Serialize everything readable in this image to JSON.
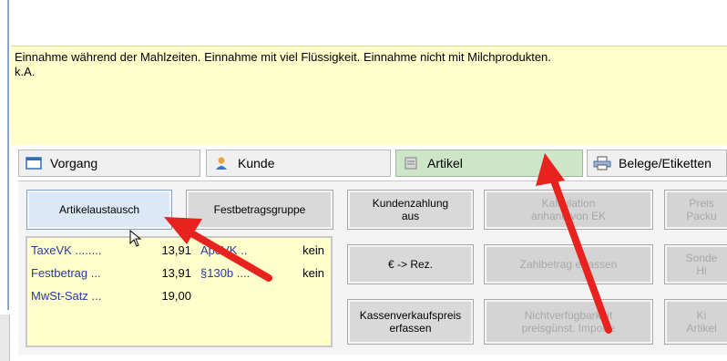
{
  "info": {
    "line1": "Einnahme während der Mahlzeiten. Einnahme mit viel Flüssigkeit. Einnahme nicht mit Milchprodukten.",
    "line2": "k.A."
  },
  "tabs": [
    {
      "label": "Vorgang",
      "icon": "window-icon"
    },
    {
      "label": "Kunde",
      "icon": "person-icon"
    },
    {
      "label": "Artikel",
      "icon": "article-icon"
    },
    {
      "label": "Belege/Etiketten",
      "icon": "printer-icon"
    }
  ],
  "buttons": {
    "artikelaustausch": "Artikelaustausch",
    "festbetragsgruppe": "Festbetragsgruppe",
    "kundenzahlung_1": "Kundenzahlung",
    "kundenzahlung_2": "aus",
    "kalkulation_1": "Kalkulation",
    "kalkulation_2": "anhand von EK",
    "preis_1": "Preis",
    "preis_2": "Packu",
    "rez": "€ -> Rez.",
    "zahlbetrag": "Zahlbetrag erfassen",
    "sonder_1": "Sonde",
    "sonder_2": "Hi",
    "kvp_1": "Kassenverkaufspreis",
    "kvp_2": "erfassen",
    "nichtverf_1": "Nichtverfügbarkeit",
    "nichtverf_2": "preisgünst. Importe",
    "artikel_1": "Ki",
    "artikel_2": "Artikel"
  },
  "prices": {
    "taxevk_label": "TaxeVK ........",
    "taxevk_value": "13,91",
    "apovk_label": "ApoVK ..",
    "apovk_value": "kein",
    "festbetrag_label": "Festbetrag ...",
    "festbetrag_value": "13,91",
    "s130b_label": "§130b ....",
    "s130b_value": "kein",
    "mwst_label": "MwSt-Satz ...",
    "mwst_value": "19,00"
  },
  "colors": {
    "info_bg": "#ffffcc",
    "active_tab": "#cde6c7",
    "annotation_arrow": "#e8231f",
    "price_label": "#2a3b9b"
  }
}
